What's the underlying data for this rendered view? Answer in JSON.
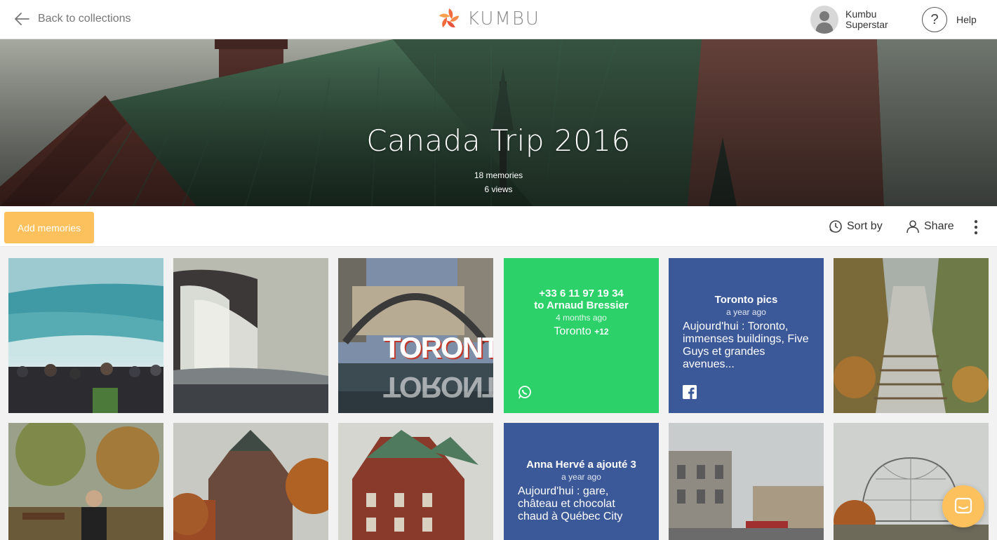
{
  "header": {
    "back_label": "Back to collections",
    "logo_text": "KUMBU",
    "user_name_line1": "Kumbu",
    "user_name_line2": "Superstar",
    "help_symbol": "?",
    "help_label": "Help"
  },
  "collection": {
    "title": "Canada Trip 2016",
    "memories": "18 memories",
    "views": "6 views"
  },
  "toolbar": {
    "add_label": "Add memories",
    "sort_label": "Sort by",
    "share_label": "Share"
  },
  "tiles": {
    "whatsapp_card": {
      "title_line1": "+33 6 11 97 19 34",
      "title_line2": "to Arnaud Bressier",
      "time": "4 months ago",
      "location": "Toronto",
      "extra": "+12",
      "icon": "whatsapp-icon"
    },
    "facebook_card_1": {
      "title": "Toronto pics",
      "time": "a year ago",
      "body": "Aujourd'hui : Toronto, immenses buildings, Five Guys et grandes avenues...",
      "icon": "facebook-icon"
    },
    "facebook_card_2": {
      "title": "Anna Hervé a ajouté 3",
      "time": "a year ago",
      "body": "Aujourd'hui : gare, château et chocolat chaud à Québec City"
    },
    "toronto_sign": "TORONTO"
  },
  "colors": {
    "accent": "#fcc15c",
    "whatsapp_green": "#2cd16a",
    "facebook_blue": "#3b5998",
    "logo_orange": "#f26b3a"
  }
}
